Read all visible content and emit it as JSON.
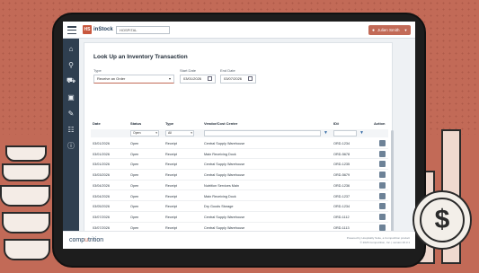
{
  "app": {
    "logo_badge": "HS",
    "name": "inStock",
    "location": "HOSPITAL",
    "user": "Julien Smith"
  },
  "sidebar": {
    "icons": [
      "home-icon",
      "search-icon",
      "truck-icon",
      "inventory-icon",
      "wrench-icon",
      "clipboard-icon",
      "help-icon"
    ]
  },
  "page": {
    "title": "Look Up an Inventory Transaction",
    "type_label": "Type",
    "type_value": "Receive an Order",
    "start_label": "Start Date",
    "start_value": "03/01/2026",
    "end_label": "End Date",
    "end_value": "03/07/2026"
  },
  "table": {
    "headers": [
      "Date",
      "Status",
      "Type",
      "Vendor/Cost Center",
      "ID#",
      "Action"
    ],
    "filters": {
      "status": "Open",
      "type": "All"
    },
    "rows": [
      {
        "date": "03/01/2026",
        "status": "Open",
        "type": "Receipt",
        "vendor": "Central Supply Warehouse",
        "id": "ORD-1234"
      },
      {
        "date": "03/01/2026",
        "status": "Open",
        "type": "Receipt",
        "vendor": "Main Receiving Dock",
        "id": "ORD-5678"
      },
      {
        "date": "03/01/2026",
        "status": "Open",
        "type": "Receipt",
        "vendor": "Central Supply Warehouse",
        "id": "ORD-1235"
      },
      {
        "date": "03/03/2026",
        "status": "Open",
        "type": "Receipt",
        "vendor": "Central Supply Warehouse",
        "id": "ORD-5679"
      },
      {
        "date": "03/04/2026",
        "status": "Open",
        "type": "Receipt",
        "vendor": "Nutrition Services Main",
        "id": "ORD-1236"
      },
      {
        "date": "03/04/2026",
        "status": "Open",
        "type": "Receipt",
        "vendor": "Main Receiving Dock",
        "id": "ORD-1237"
      },
      {
        "date": "03/05/2026",
        "status": "Open",
        "type": "Receipt",
        "vendor": "Dry Goods Storage",
        "id": "ORD-1234"
      },
      {
        "date": "03/07/2026",
        "status": "Open",
        "type": "Receipt",
        "vendor": "Central Supply Warehouse",
        "id": "ORD-1112"
      },
      {
        "date": "03/07/2026",
        "status": "Open",
        "type": "Receipt",
        "vendor": "Central Supply Warehouse",
        "id": "ORD-1113"
      }
    ]
  },
  "footer": {
    "brand_a": "comp",
    "brand_o": "u",
    "brand_b": "trition",
    "legal_1": "Powered by Hospitality Suite, a Computrition product",
    "legal_2": "© 2026 Computrition, Inc. | version 26.3.1"
  },
  "colors": {
    "accent": "#c26a57",
    "sidebar": "#2f3f50",
    "background": "#c26a57"
  }
}
